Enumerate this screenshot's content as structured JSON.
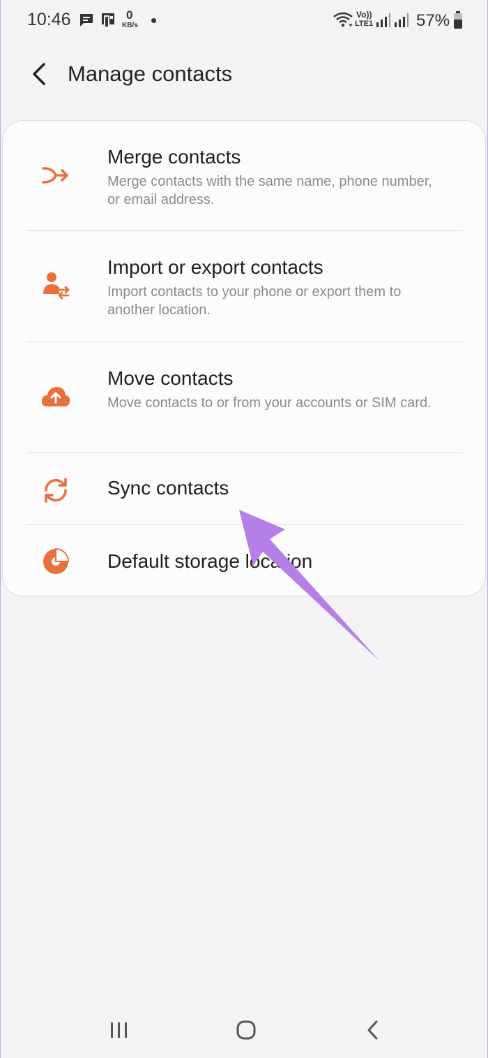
{
  "status_bar": {
    "time": "10:46",
    "speed_value": "0",
    "speed_unit": "KB/s",
    "volte": "Vo))",
    "lte": "LTE1",
    "battery": "57%"
  },
  "header": {
    "title": "Manage contacts"
  },
  "menu": {
    "items": [
      {
        "title": "Merge contacts",
        "subtitle": "Merge contacts with the same name, phone number, or email address.",
        "icon": "merge-icon"
      },
      {
        "title": "Import or export contacts",
        "subtitle": "Import contacts to your phone or export them to another location.",
        "icon": "import-export-icon"
      },
      {
        "title": "Move contacts",
        "subtitle": "Move contacts to or from your accounts or SIM card.",
        "icon": "cloud-upload-icon"
      },
      {
        "title": "Sync contacts",
        "subtitle": "",
        "icon": "sync-icon"
      },
      {
        "title": "Default storage location",
        "subtitle": "",
        "icon": "storage-pie-icon"
      }
    ]
  },
  "colors": {
    "accent": "#e8703a",
    "annotation": "#b47fe6",
    "background": "#f3f2f4"
  }
}
